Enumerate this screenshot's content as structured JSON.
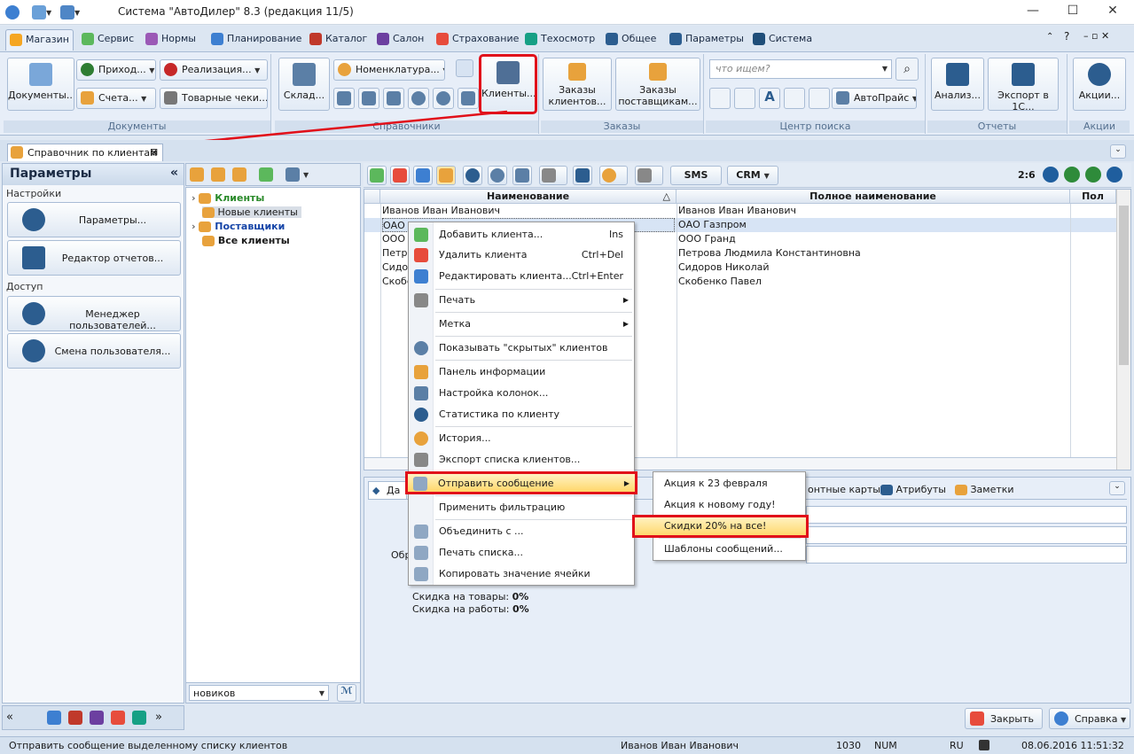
{
  "window": {
    "title": "Система \"АвтоДилер\" 8.3 (редакция 11/5)",
    "minimize": "—",
    "maximize": "☐",
    "close": "✕"
  },
  "ribbon_tabs": [
    "Магазин",
    "Сервис",
    "Нормы",
    "Планирование",
    "Каталог",
    "Салон",
    "Страхование",
    "Техосмотр",
    "Общее",
    "Параметры",
    "Система"
  ],
  "ribbon": {
    "documents": {
      "big": "Документы...",
      "income": "Приход...",
      "sales": "Реализация...",
      "invoices": "Счета...",
      "receipts": "Товарные чеки...",
      "group": "Документы"
    },
    "refs": {
      "warehouse": "Склад...",
      "nomenclature": "Номенклатура...",
      "clients": "Клиенты...",
      "group": "Справочники"
    },
    "orders": {
      "client_orders": "Заказы клиентов...",
      "supplier_orders": "Заказы поставщикам...",
      "group": "Заказы"
    },
    "search": {
      "placeholder": "что ищем?",
      "autoprice": "АвтоПрайс",
      "group": "Центр поиска"
    },
    "reports": {
      "analysis": "Анализ...",
      "export1c": "Экспорт в 1С...",
      "group": "Отчеты"
    },
    "promos": {
      "promos": "Акции...",
      "group": "Акции"
    }
  },
  "doc_tab": {
    "label": "Справочник по клиентам",
    "close": "⊠"
  },
  "left": {
    "title": "Параметры",
    "collapse": "«",
    "settings_label": "Настройки",
    "params_btn": "Параметры...",
    "reports_btn": "Редактор отчетов...",
    "access_label": "Доступ",
    "users_btn": "Менеджер пользователей...",
    "switch_btn": "Смена пользователя..."
  },
  "tree": {
    "items": [
      "Клиенты",
      "Новые клиенты",
      "Поставщики",
      "Все клиенты"
    ],
    "filter_value": "новиков"
  },
  "grid": {
    "toolbar": {
      "sms": "SMS",
      "crm": "CRM",
      "counter": "2:6"
    },
    "columns": [
      "Наименование",
      "Полное наименование",
      "Пол"
    ],
    "rows": [
      {
        "name": "Иванов Иван Иванович",
        "full": "Иванов Иван Иванович"
      },
      {
        "name": "ОАО Г",
        "full": "ОАО Газпром"
      },
      {
        "name": "ООО Г",
        "full": "ООО Гранд"
      },
      {
        "name": "Петро",
        "full": "Петрова Людмила Константиновна"
      },
      {
        "name": "Сидор",
        "full": "Сидоров Николай"
      },
      {
        "name": "Скобе",
        "full": "Скобенко Павел"
      }
    ]
  },
  "info": {
    "tab_partial": "Да",
    "tabs": [
      "онтные карты",
      "Атрибуты",
      "Заметки"
    ],
    "obr_label": "Обр",
    "discount_goods_label": "Скидка на товары:",
    "discount_goods": "0%",
    "discount_work_label": "Скидка на работы:",
    "discount_work": "0%"
  },
  "context_menu": [
    {
      "label": "Добавить клиента...",
      "shortcut": "Ins"
    },
    {
      "label": "Удалить клиента",
      "shortcut": "Ctrl+Del"
    },
    {
      "label": "Редактировать клиента...",
      "shortcut": "Ctrl+Enter"
    },
    {
      "label": "Печать",
      "shortcut": ""
    },
    {
      "label": "Метка",
      "shortcut": ""
    },
    {
      "label": "Показывать \"скрытых\" клиентов",
      "shortcut": ""
    },
    {
      "label": "Панель информации",
      "shortcut": ""
    },
    {
      "label": "Настройка колонок...",
      "shortcut": ""
    },
    {
      "label": "Статистика по клиенту",
      "shortcut": ""
    },
    {
      "label": "История...",
      "shortcut": ""
    },
    {
      "label": "Экспорт списка клиентов...",
      "shortcut": ""
    },
    {
      "label": "Отправить сообщение",
      "shortcut": ""
    },
    {
      "label": "Применить фильтрацию",
      "shortcut": ""
    },
    {
      "label": "Объединить с ...",
      "shortcut": ""
    },
    {
      "label": "Печать списка...",
      "shortcut": ""
    },
    {
      "label": "Копировать значение ячейки",
      "shortcut": ""
    }
  ],
  "submenu": [
    "Акция к 23 февраля",
    "Акция к новому году!",
    "Скидки 20% на все!",
    "Шаблоны сообщений..."
  ],
  "footer": {
    "close": "Закрыть",
    "help": "Справка"
  },
  "status": {
    "hint": "Отправить сообщение выделенному списку клиентов",
    "user": "Иванов Иван Иванович",
    "code": "1030",
    "num": "NUM",
    "lang": "RU",
    "datetime": "08.06.2016 11:51:32"
  },
  "colors": {
    "accent": "#e1101a",
    "hot": "#ffd76a",
    "ribbon": "#e7eef8"
  }
}
